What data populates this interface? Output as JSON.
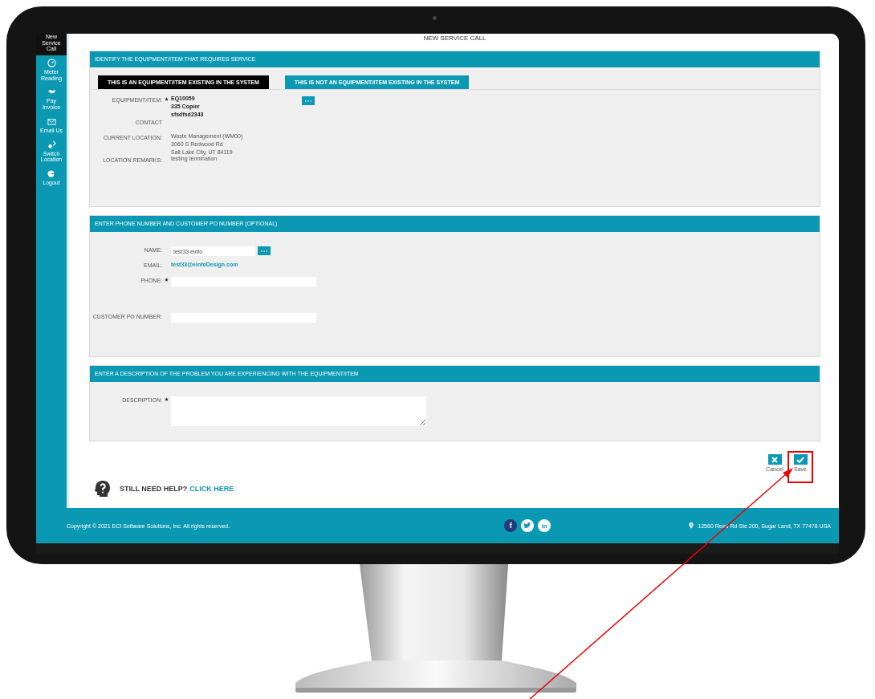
{
  "sidebar": {
    "items": [
      {
        "label": "New Service Call",
        "kind": "new",
        "selected": true
      },
      {
        "label": "Meter Reading",
        "kind": "meter",
        "selected": false
      },
      {
        "label": "Pay Invoice",
        "kind": "pay",
        "selected": false
      },
      {
        "label": "Email Us",
        "kind": "email",
        "selected": false
      },
      {
        "label": "Switch Location",
        "kind": "switch",
        "selected": false
      },
      {
        "label": "Logout",
        "kind": "logout",
        "selected": false
      }
    ]
  },
  "page_title": "NEW SERVICE CALL",
  "equipment_section": {
    "title": "IDENTIFY THE EQUIPMENT/ITEM THAT REQUIRES SERVICE",
    "tabs": [
      {
        "label": "THIS IS AN EQUIPMENT/ITEM EXISTING IN THE SYSTEM",
        "selected": true
      },
      {
        "label": "THIS IS NOT AN EQUIPMENT/ITEM EXISTING IN THE SYSTEM",
        "selected": false
      }
    ],
    "fields": [
      {
        "label": "EQUIPMENT/ITEM:",
        "required": true,
        "kind": "lookup",
        "lines": [
          "EQ10059",
          "335 Copier",
          "sfsdfsd2343"
        ]
      },
      {
        "label": "CONTACT",
        "required": false,
        "kind": "text"
      },
      {
        "label": "CURRENT LOCATION:",
        "required": false,
        "kind": "text",
        "lines": [
          "Waste Management (WM00)",
          "3060 S Redwood Rd",
          "Salt Lake City, UT 84119"
        ]
      },
      {
        "label": "LOCATION REMARKS:",
        "required": false,
        "kind": "text",
        "lines": [
          "testing termination"
        ]
      }
    ]
  },
  "contact_section": {
    "title": "ENTER PHONE NUMBER AND CUSTOMER PO NUMBER (OPTIONAL)",
    "fields": [
      {
        "label": "NAME:",
        "required": false,
        "kind": "lookup-input",
        "value": "test33 einfo"
      },
      {
        "label": "EMAIL:",
        "required": false,
        "kind": "link",
        "value": "test33@einfoDesign.com"
      },
      {
        "label": "PHONE:",
        "required": true,
        "kind": "input"
      },
      {
        "label": "CUSTOMER PO NUMBER:",
        "required": false,
        "kind": "input"
      }
    ]
  },
  "description_section": {
    "title": "ENTER A DESCRIPTION OF THE PROBLEM YOU ARE EXPERIENCING WITH THE EQUIPMENT/ITEM",
    "fields": [
      {
        "label": "DESCRIPTION:",
        "required": true,
        "kind": "textarea"
      }
    ]
  },
  "actions": [
    {
      "kind": "cancel",
      "label": "Cancel"
    },
    {
      "kind": "save",
      "label": "Save"
    }
  ],
  "help": {
    "text": "STILL NEED HELP?",
    "link": "CLICK HERE"
  },
  "footer": {
    "copyright": "Copyright © 2021 ECI Software Solutions, Inc. All rights reserved.",
    "social": [
      {
        "kind": "facebook",
        "glyph": "f"
      },
      {
        "kind": "twitter"
      },
      {
        "kind": "linkedin",
        "glyph": "in"
      }
    ],
    "address": "12560 Reed Rd Ste 200, Sugar Land, TX 77478 USA"
  }
}
